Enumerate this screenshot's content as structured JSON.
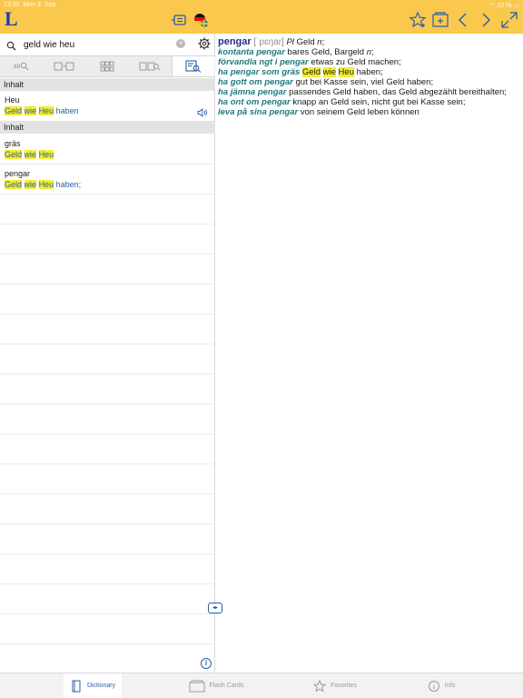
{
  "status": {
    "time": "13:20",
    "date": "Mon 3. Sep",
    "battery": "22 %"
  },
  "header": {
    "logo": "L"
  },
  "search": {
    "value": "geld wie heu",
    "placeholder": ""
  },
  "modes": [
    "ab",
    "",
    "",
    "",
    ""
  ],
  "sections": [
    {
      "title": "Inhalt",
      "results": [
        {
          "head": "Heu",
          "hl": [
            "Geld",
            "wie",
            "Heu"
          ],
          "rest": "haben"
        }
      ]
    },
    {
      "title": "Inhalt",
      "results": [
        {
          "head": "gräs",
          "hl": [
            "Geld",
            "wie",
            "Heu"
          ],
          "rest": ""
        },
        {
          "head": "pengar",
          "hl": [
            "Geld",
            "wie",
            "Heu"
          ],
          "rest": "haben;"
        }
      ]
    }
  ],
  "entry": {
    "lemma": "pengar",
    "pron": "[ˈpɛŋar]",
    "pos": "Pl",
    "trans": "Geld",
    "gram": "n",
    "lines": [
      {
        "phrase": "kontanta pengar",
        "text": "bares Geld, Bargeld",
        "gram": "n",
        "after": ";"
      },
      {
        "phrase": "förvandla ngt i pengar",
        "text": "etwas zu Geld machen;"
      },
      {
        "phrase": "ha pengar som gräs",
        "hl": [
          "Geld",
          "wie",
          "Heu"
        ],
        "text": "haben;"
      },
      {
        "phrase": "ha gott om pengar",
        "text": "gut bei Kasse sein, viel Geld haben;"
      },
      {
        "phrase": "ha jämna pengar",
        "text": "passendes Geld haben, das Geld abgezählt bereithalten;"
      },
      {
        "phrase": "ha ont om pengar",
        "text": "knapp an Geld sein, nicht gut bei Kasse sein;"
      },
      {
        "phrase": "leva på sina pengar",
        "text": "von seinem Geld leben können"
      }
    ]
  },
  "tabs": [
    {
      "label": "Dictionary",
      "active": true
    },
    {
      "label": "Flash Cards",
      "active": false
    },
    {
      "label": "Favorites",
      "active": false
    },
    {
      "label": "Info",
      "active": false
    }
  ],
  "info_label": "i",
  "colors": {
    "header": "#f9c84d",
    "accent": "#2a5fa8",
    "highlight": "#f4ee2c",
    "phrase": "#1f7a7e"
  }
}
